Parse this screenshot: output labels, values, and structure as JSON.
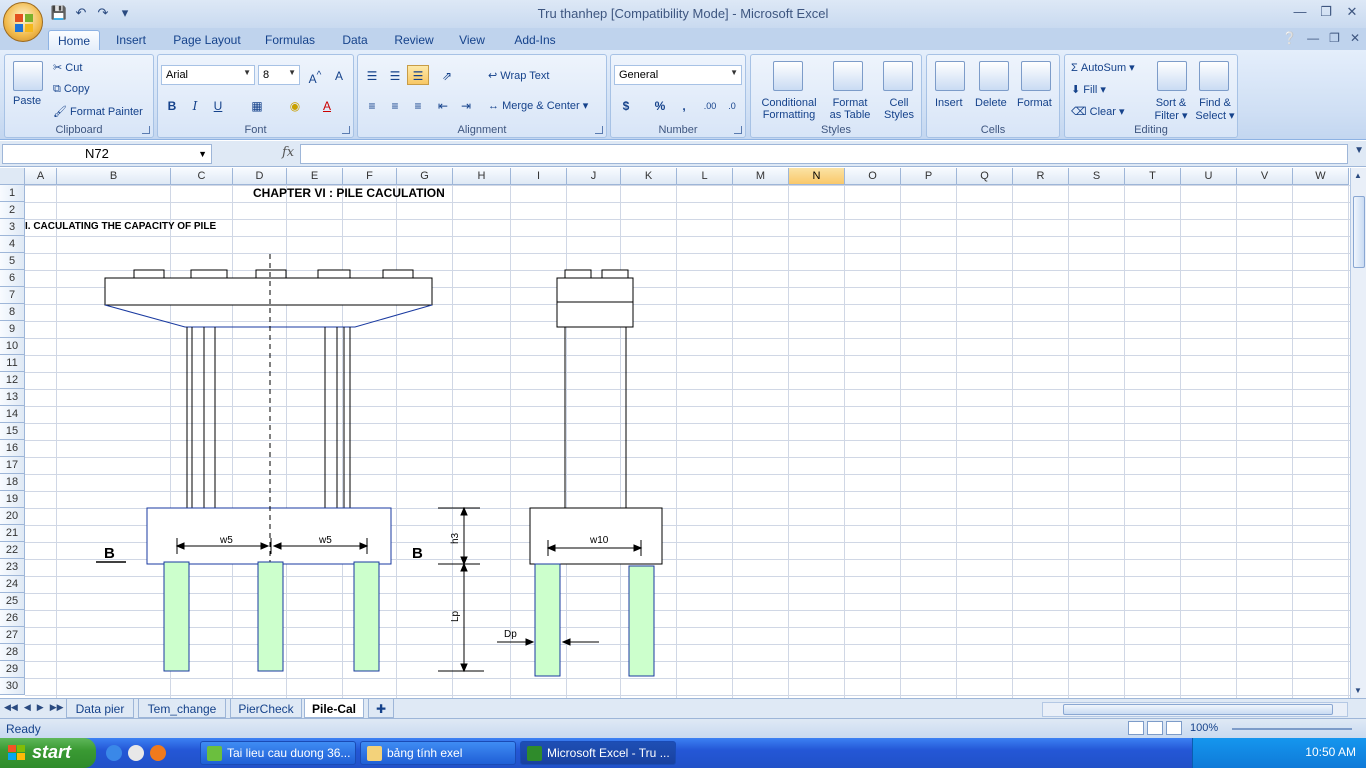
{
  "window": {
    "title": "Tru thanhep  [Compatibility Mode] - Microsoft Excel"
  },
  "ribbon": {
    "tabs": [
      "Home",
      "Insert",
      "Page Layout",
      "Formulas",
      "Data",
      "Review",
      "View",
      "Add-Ins"
    ],
    "active_tab": "Home",
    "clipboard": {
      "label": "Clipboard",
      "paste": "Paste",
      "cut": "Cut",
      "copy": "Copy",
      "format_painter": "Format Painter"
    },
    "font": {
      "label": "Font",
      "name": "Arial",
      "size": "8"
    },
    "alignment": {
      "label": "Alignment",
      "wrap_text": "Wrap Text",
      "merge_center": "Merge & Center"
    },
    "number": {
      "label": "Number",
      "format": "General",
      "currency": "$",
      "percent": "%",
      "comma": ","
    },
    "styles": {
      "label": "Styles",
      "conditional_1": "Conditional",
      "conditional_2": "Formatting",
      "format_table_1": "Format",
      "format_table_2": "as Table",
      "cell_styles_1": "Cell",
      "cell_styles_2": "Styles"
    },
    "cells": {
      "label": "Cells",
      "insert": "Insert",
      "delete": "Delete",
      "format": "Format"
    },
    "editing": {
      "label": "Editing",
      "autosum": "AutoSum",
      "fill": "Fill",
      "clear": "Clear",
      "sort_1": "Sort &",
      "sort_2": "Filter",
      "find_1": "Find &",
      "find_2": "Select"
    }
  },
  "formula_bar": {
    "name_box": "N72",
    "fx": "fx",
    "value": ""
  },
  "sheet": {
    "columns": [
      "A",
      "B",
      "C",
      "D",
      "E",
      "F",
      "G",
      "H",
      "I",
      "J",
      "K",
      "L",
      "M",
      "N",
      "O",
      "P",
      "Q",
      "R",
      "S",
      "T",
      "U",
      "V",
      "W"
    ],
    "selected_column": "N",
    "rows": [
      "1",
      "2",
      "3",
      "4",
      "5",
      "6",
      "7",
      "8",
      "9",
      "10",
      "11",
      "12",
      "13",
      "14",
      "15",
      "16",
      "17",
      "18",
      "19",
      "20",
      "21",
      "22",
      "23",
      "24",
      "25",
      "26",
      "27",
      "28",
      "29",
      "30"
    ],
    "cells": {
      "chapter_title": "CHAPTER VI : PILE CACULATION",
      "section_title": "I. CACULATING THE CAPACITY OF PILE"
    },
    "drawing_labels": {
      "w5_left": "w5",
      "w5_right": "w5",
      "w10": "w10",
      "h3": "h3",
      "lp": "Lp",
      "dp": "Dp",
      "section_b_left": "B",
      "section_b_right": "B"
    }
  },
  "sheet_tabs": [
    {
      "name": "Data pier",
      "active": false
    },
    {
      "name": "Tem_change",
      "active": false
    },
    {
      "name": "PierCheck",
      "active": false
    },
    {
      "name": "Pile-Cal",
      "active": true
    }
  ],
  "status": {
    "text": "Ready",
    "zoom": "100%"
  },
  "taskbar": {
    "start": "start",
    "items": [
      "Tai lieu cau duong 36...",
      "bảng tính exel",
      "Microsoft Excel - Tru ..."
    ],
    "clock": "10:50 AM"
  },
  "colors": {
    "accent": "#15428b",
    "pile_fill": "#ccffcc",
    "selected_header": "#f9c86a"
  }
}
